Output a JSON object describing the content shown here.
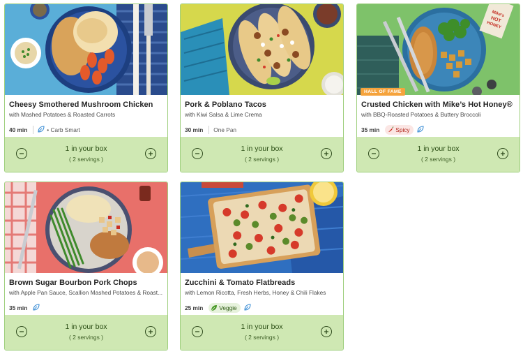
{
  "recipes": [
    {
      "title": "Cheesy Smothered Mushroom Chicken",
      "subtitle": "with Mashed Potatoes & Roasted Carrots",
      "time": "40 min",
      "tags": [
        "• Carb Smart"
      ],
      "quantity_label": "1 in your box",
      "servings_label": "( 2 servings )"
    },
    {
      "title": "Pork & Poblano Tacos",
      "subtitle": "with Kiwi Salsa & Lime Crema",
      "time": "30 min",
      "tags": [
        "One Pan"
      ],
      "quantity_label": "1 in your box",
      "servings_label": "( 2 servings )"
    },
    {
      "title": "Crusted Chicken with Mike’s Hot Honey®",
      "subtitle": "with BBQ-Roasted Potatoes & Buttery Broccoli",
      "time": "35 min",
      "badge": "HALL OF FAME",
      "tags": [
        "Spicy"
      ],
      "quantity_label": "1 in your box",
      "servings_label": "( 2 servings )"
    },
    {
      "title": "Brown Sugar Bourbon Pork Chops",
      "subtitle": "with Apple Pan Sauce, Scallion Mashed Potatoes & Roast...",
      "time": "35 min",
      "tags": [],
      "quantity_label": "1 in your box",
      "servings_label": "( 2 servings )"
    },
    {
      "title": "Zucchini & Tomato Flatbreads",
      "subtitle": "with Lemon Ricotta, Fresh Herbs, Honey & Chili Flakes",
      "time": "25 min",
      "tags": [
        "Veggie"
      ],
      "quantity_label": "1 in your box",
      "servings_label": "( 2 servings )"
    }
  ],
  "logo_text": "Mike's HOT HONEY",
  "colors": {
    "card_border": "#9ecf7d",
    "box_bar": "#cfe8b3",
    "badge": "#f5a33c",
    "spicy": "#b02318",
    "veggie": "#2d5a12",
    "dark_green": "#2e4a1c"
  },
  "icons": [
    "minus-circle-icon",
    "plus-circle-icon",
    "leaf-icon",
    "chili-icon",
    "veggie-leaf-icon"
  ]
}
